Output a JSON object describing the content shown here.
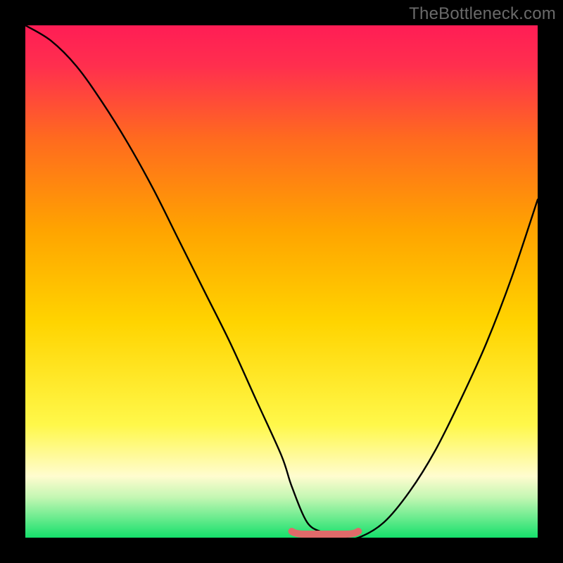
{
  "attribution": "TheBottleneck.com",
  "colors": {
    "background": "#000000",
    "gradient_top": "#ff1d55",
    "gradient_mid1": "#ff6a1f",
    "gradient_mid2": "#ffd400",
    "gradient_mid3": "#fffa8a",
    "gradient_bottom": "#15e06b",
    "curve": "#000000",
    "optimal_band": "#e06a6a",
    "attribution_text": "#6a6a6a"
  },
  "chart_data": {
    "type": "line",
    "title": "",
    "xlabel": "",
    "ylabel": "",
    "xlim": [
      0,
      100
    ],
    "ylim": [
      0,
      100
    ],
    "grid": false,
    "legend": null,
    "series": [
      {
        "name": "bottleneck-curve",
        "x": [
          0,
          5,
          10,
          15,
          20,
          25,
          30,
          35,
          40,
          45,
          50,
          52,
          55,
          58,
          60,
          62,
          65,
          70,
          75,
          80,
          85,
          90,
          95,
          100
        ],
        "values": [
          100,
          97,
          92,
          85,
          77,
          68,
          58,
          48,
          38,
          27,
          16,
          10,
          3,
          1,
          0,
          0,
          0,
          3,
          9,
          17,
          27,
          38,
          51,
          66
        ]
      }
    ],
    "optimal_band": {
      "x_range": [
        52,
        65
      ],
      "y": 0
    },
    "gradient_stops": [
      {
        "offset": 0.0,
        "color": "#ff1d55"
      },
      {
        "offset": 0.08,
        "color": "#ff2f4e"
      },
      {
        "offset": 0.22,
        "color": "#ff6a1f"
      },
      {
        "offset": 0.4,
        "color": "#ffa400"
      },
      {
        "offset": 0.58,
        "color": "#ffd400"
      },
      {
        "offset": 0.78,
        "color": "#fff84a"
      },
      {
        "offset": 0.88,
        "color": "#fffccf"
      },
      {
        "offset": 0.92,
        "color": "#c6f7b4"
      },
      {
        "offset": 1.0,
        "color": "#15e06b"
      }
    ]
  }
}
